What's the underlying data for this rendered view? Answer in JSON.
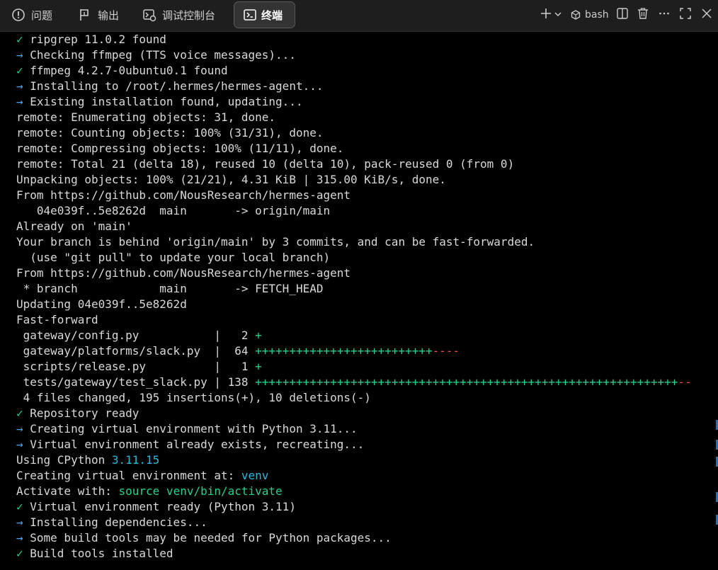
{
  "tabs": [
    {
      "label": "问题",
      "icon": "alert-circle-icon"
    },
    {
      "label": "输出",
      "icon": "output-flag-icon"
    },
    {
      "label": "调试控制台",
      "icon": "debug-console-icon"
    },
    {
      "label": "终端",
      "icon": "terminal-icon",
      "active": true
    }
  ],
  "toolbar": {
    "shell_label": "bash",
    "new_icon": "plus-icon",
    "dropdown_icon": "chevron-down-icon",
    "shell_icon": "shell-cube-icon",
    "split_icon": "split-editor-icon",
    "trash_icon": "trash-icon",
    "more_icon": "more-icon",
    "maximize_icon": "maximize-icon",
    "close_icon": "close-icon"
  },
  "colors": {
    "success": "#23d18b",
    "arrow": "#4aa3ff",
    "highlight": "#29b8db",
    "deletion": "#f14c4c",
    "text": "#d9d9d9"
  },
  "terminal": {
    "lines": [
      [
        {
          "t": "✓ ",
          "c": "ok"
        },
        {
          "t": "ripgrep 11.0.2 found"
        }
      ],
      [
        {
          "t": "→ ",
          "c": "arrow"
        },
        {
          "t": "Checking ffmpeg (TTS voice messages)..."
        }
      ],
      [
        {
          "t": "✓ ",
          "c": "ok"
        },
        {
          "t": "ffmpeg 4.2.7-0ubuntu0.1 found"
        }
      ],
      [
        {
          "t": "→ ",
          "c": "arrow"
        },
        {
          "t": "Installing to /root/.hermes/hermes-agent..."
        }
      ],
      [
        {
          "t": "→ ",
          "c": "arrow"
        },
        {
          "t": "Existing installation found, updating..."
        }
      ],
      [
        {
          "t": "remote: Enumerating objects: 31, done."
        }
      ],
      [
        {
          "t": "remote: Counting objects: 100% (31/31), done."
        }
      ],
      [
        {
          "t": "remote: Compressing objects: 100% (11/11), done."
        }
      ],
      [
        {
          "t": "remote: Total 21 (delta 18), reused 10 (delta 10), pack-reused 0 (from 0)"
        }
      ],
      [
        {
          "t": "Unpacking objects: 100% (21/21), 4.31 KiB | 315.00 KiB/s, done."
        }
      ],
      [
        {
          "t": "From https://github.com/NousResearch/hermes-agent"
        }
      ],
      [
        {
          "t": "   04e039f..5e8262d  main       -> origin/main"
        }
      ],
      [
        {
          "t": "Already on 'main'"
        }
      ],
      [
        {
          "t": "Your branch is behind 'origin/main' by 3 commits, and can be fast-forwarded."
        }
      ],
      [
        {
          "t": "  (use \"git pull\" to update your local branch)"
        }
      ],
      [
        {
          "t": "From https://github.com/NousResearch/hermes-agent"
        }
      ],
      [
        {
          "t": " * branch            main       -> FETCH_HEAD"
        }
      ],
      [
        {
          "t": "Updating 04e039f..5e8262d"
        }
      ],
      [
        {
          "t": "Fast-forward"
        }
      ],
      [
        {
          "t": " gateway/config.py           |   2 "
        },
        {
          "t": "+",
          "c": "green"
        }
      ],
      [
        {
          "t": " gateway/platforms/slack.py  |  64 "
        },
        {
          "t": "++++++++++++++++++++++++++",
          "c": "green"
        },
        {
          "t": "----",
          "c": "red"
        }
      ],
      [
        {
          "t": " scripts/release.py          |   1 "
        },
        {
          "t": "+",
          "c": "green"
        }
      ],
      [
        {
          "t": " tests/gateway/test_slack.py | 138 "
        },
        {
          "t": "++++++++++++++++++++++++++++++++++++++++++++++++++++++++++++++",
          "c": "green"
        },
        {
          "t": "--",
          "c": "red"
        }
      ],
      [
        {
          "t": " 4 files changed, 195 insertions(+), 10 deletions(-)"
        }
      ],
      [
        {
          "t": "✓ ",
          "c": "ok"
        },
        {
          "t": "Repository ready"
        }
      ],
      [
        {
          "t": "→ ",
          "c": "arrow"
        },
        {
          "t": "Creating virtual environment with Python 3.11..."
        }
      ],
      [
        {
          "t": "→ ",
          "c": "arrow"
        },
        {
          "t": "Virtual environment already exists, recreating..."
        }
      ],
      [
        {
          "t": "Using CPython "
        },
        {
          "t": "3.11.15",
          "c": "blue"
        }
      ],
      [
        {
          "t": "Creating virtual environment at: "
        },
        {
          "t": "venv",
          "c": "blue"
        }
      ],
      [
        {
          "t": "Activate with: "
        },
        {
          "t": "source venv/bin/activate",
          "c": "green"
        }
      ],
      [
        {
          "t": "✓ ",
          "c": "ok"
        },
        {
          "t": "Virtual environment ready (Python 3.11)"
        }
      ],
      [
        {
          "t": "→ ",
          "c": "arrow"
        },
        {
          "t": "Installing dependencies..."
        }
      ],
      [
        {
          "t": "→ ",
          "c": "arrow"
        },
        {
          "t": "Some build tools may be needed for Python packages..."
        }
      ],
      [
        {
          "t": "✓ ",
          "c": "ok"
        },
        {
          "t": "Build tools installed"
        }
      ]
    ]
  }
}
